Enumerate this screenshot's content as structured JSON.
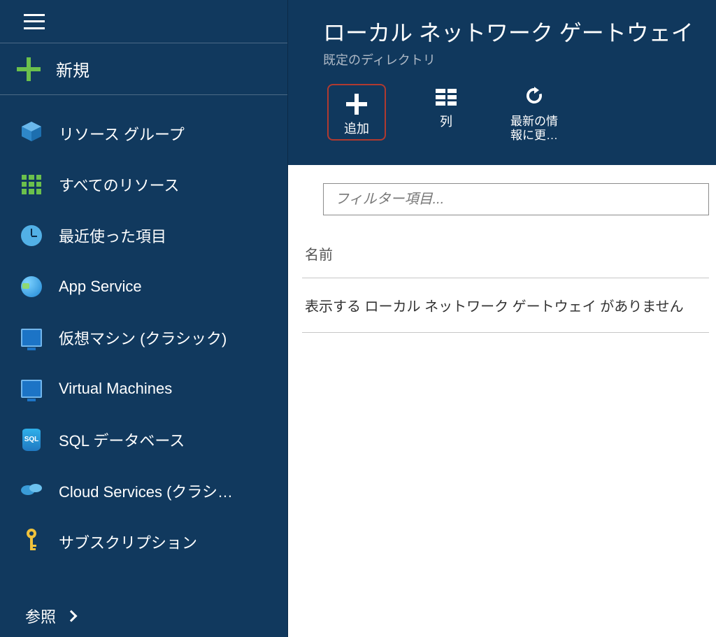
{
  "sidebar": {
    "new_label": "新規",
    "browse_label": "参照",
    "items": [
      {
        "label": "リソース グループ"
      },
      {
        "label": "すべてのリソース"
      },
      {
        "label": "最近使った項目"
      },
      {
        "label": "App Service"
      },
      {
        "label": "仮想マシン (クラシック)"
      },
      {
        "label": "Virtual Machines"
      },
      {
        "label": "SQL データベース"
      },
      {
        "label": "Cloud Services (クラシ…"
      },
      {
        "label": "サブスクリプション"
      }
    ]
  },
  "blade": {
    "title": "ローカル ネットワーク ゲートウェイ",
    "subtitle": "既定のディレクトリ",
    "toolbar": {
      "add": "追加",
      "columns": "列",
      "refresh": "最新の情報に更…"
    },
    "filter_placeholder": "フィルター項目...",
    "column_header": "名前",
    "empty_message": "表示する ローカル ネットワーク ゲートウェイ がありません"
  },
  "icons": {
    "sql_text": "SQL"
  }
}
